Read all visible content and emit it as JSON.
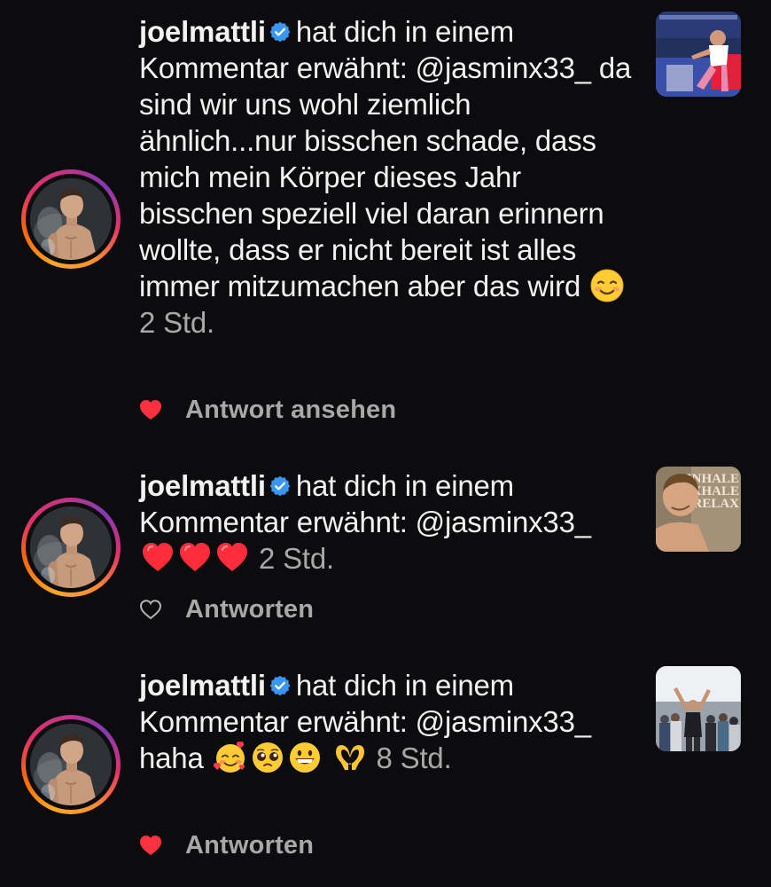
{
  "notifications": [
    {
      "username": "joelmattli",
      "action_text": "hat dich in einem Kommentar erwähnt:",
      "mention": "@jasminx33_",
      "comment": "da sind wir uns wohl ziemlich ähnlich...nur bisschen schade, dass mich mein Körper dieses Jahr bisschen speziell viel daran erinnern wollte, dass er nicht bereit ist alles immer mitzumachen aber das wird",
      "emojis": [
        "smiling-face-emoji"
      ],
      "time": "2 Std.",
      "liked": true,
      "reply_label": "Antwort ansehen",
      "thumbnail": "sports-post-thumbnail"
    },
    {
      "username": "joelmattli",
      "action_text": "hat dich in einem Kommentar erwähnt:",
      "mention": "@jasminx33_",
      "comment": "",
      "emojis": [
        "red-heart-emoji",
        "red-heart-emoji",
        "red-heart-emoji"
      ],
      "time": "2 Std.",
      "liked": false,
      "reply_label": "Antworten",
      "thumbnail": "selfie-post-thumbnail",
      "thumbnail_text": [
        "INHALE",
        "EXHALE",
        "RELAX"
      ]
    },
    {
      "username": "joelmattli",
      "action_text": "hat dich in einem Kommentar erwähnt:",
      "mention": "@jasminx33_",
      "comment": "haha",
      "emojis": [
        "smiling-face-with-hearts-emoji",
        "pleading-face-emoji",
        "grinning-face-emoji",
        "heart-hands-emoji"
      ],
      "time": "8 Std.",
      "liked": true,
      "reply_label": "Antworten",
      "thumbnail": "crowd-post-thumbnail"
    }
  ],
  "colors": {
    "background": "#0c0c0f",
    "text": "#f2f2f2",
    "secondary": "#a8a8a8",
    "like_red": "#ff3040",
    "verified_blue": "#3897f0"
  }
}
